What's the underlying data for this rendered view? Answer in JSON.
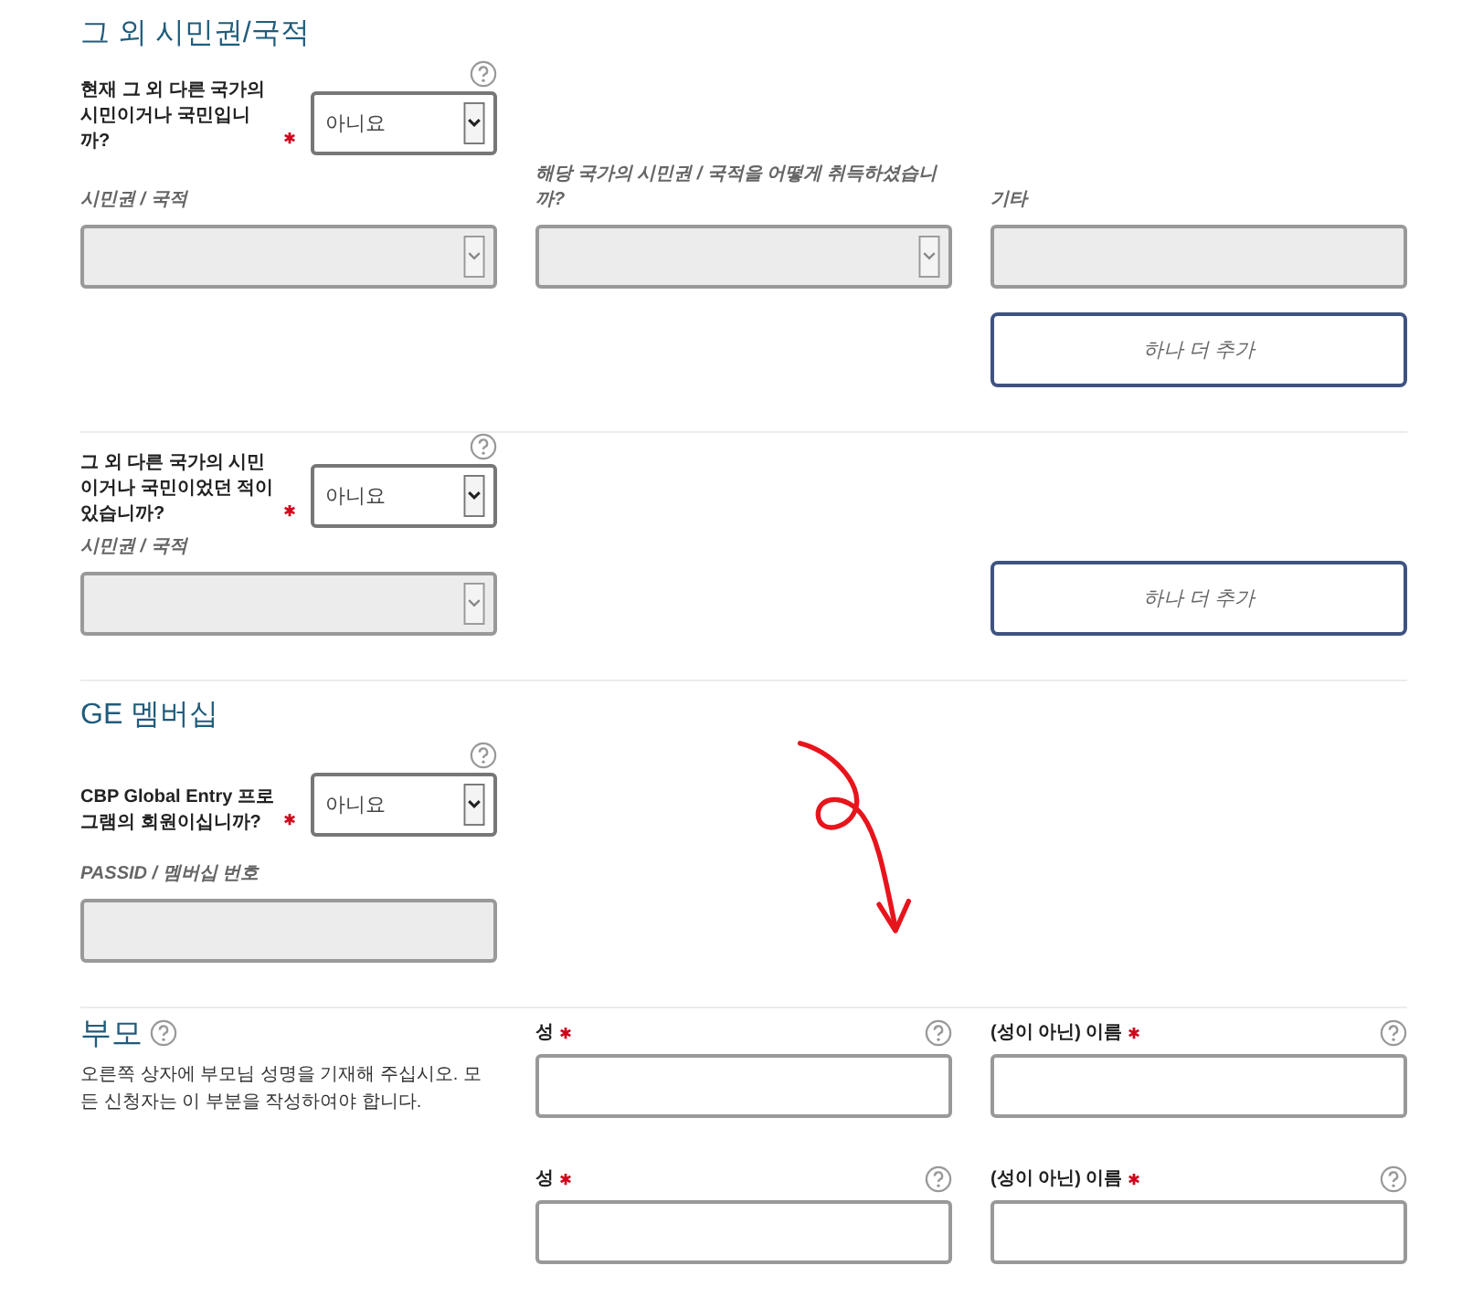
{
  "citizenship": {
    "title": "그 외 시민권/국적",
    "current_question": {
      "label": "현재 그 외 다른 국가의 시민이거나 국민입니까?",
      "required": true,
      "help": true,
      "value": "아니요"
    },
    "fields": [
      {
        "label": "시민권 / 국적",
        "kind": "select",
        "disabled": true
      },
      {
        "label": "해당 국가의 시민권 / 국적을 어떻게 취득하셨습니까?",
        "kind": "select",
        "disabled": true
      },
      {
        "label": "기타",
        "kind": "text",
        "disabled": true
      }
    ],
    "add_button": "하나 더 추가",
    "past_question": {
      "label": "그 외 다른 국가의 시민이거나 국민이었던 적이 있습니까?",
      "required": true,
      "help": true,
      "value": "아니요"
    },
    "past_fields": [
      {
        "label": "시민권 / 국적",
        "kind": "select",
        "disabled": true
      }
    ],
    "past_add_button": "하나 더 추가"
  },
  "ge_membership": {
    "title": "GE 멤버십",
    "question": {
      "label": "CBP Global Entry 프로그램의 회원이십니까?",
      "required": true,
      "help": true,
      "value": "아니요"
    },
    "fields": [
      {
        "label": "PASSID / 멤버십 번호",
        "kind": "text",
        "disabled": true
      }
    ]
  },
  "parents": {
    "title": "부모",
    "help": true,
    "description": "오른쪽 상자에 부모님 성명을 기재해 주십시오. 모든 신청자는 이 부분을 작성하여야 합니다.",
    "rows": [
      [
        {
          "label": "성",
          "required": true,
          "help": true,
          "kind": "text",
          "disabled": false
        },
        {
          "label": "(성이 아닌) 이름",
          "required": true,
          "help": true,
          "kind": "text",
          "disabled": false
        }
      ],
      [
        {
          "label": "성",
          "required": true,
          "help": true,
          "kind": "text",
          "disabled": false
        },
        {
          "label": "(성이 아닌) 이름",
          "required": true,
          "help": true,
          "kind": "text",
          "disabled": false
        }
      ]
    ]
  }
}
